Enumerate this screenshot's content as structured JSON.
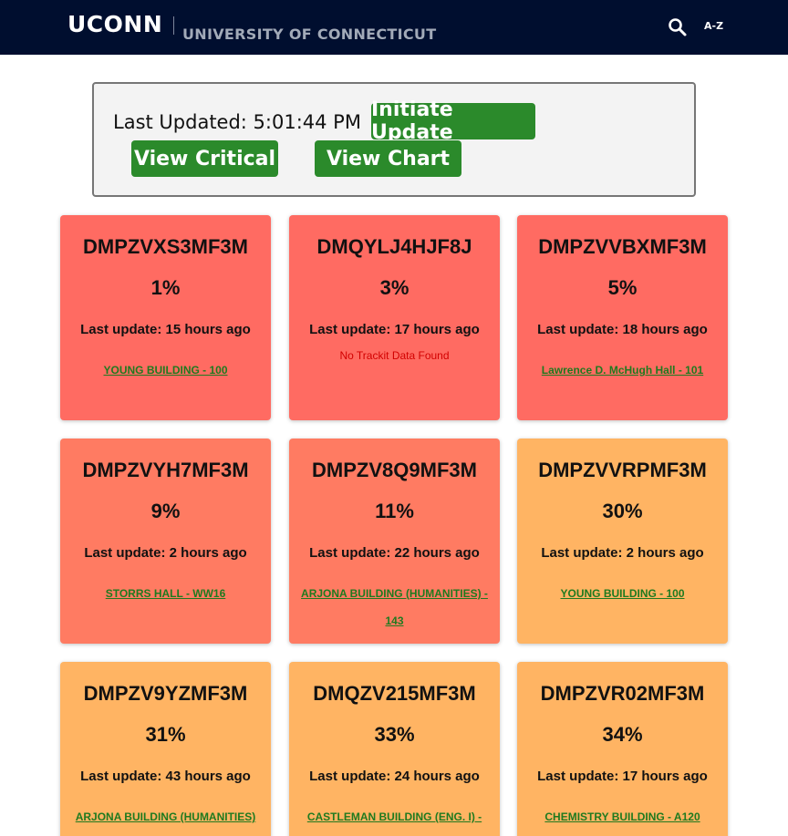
{
  "header": {
    "logo_word": "UCONN",
    "logo_subtitle": "UNIVERSITY OF CONNECTICUT",
    "az_label": "A-Z",
    "search_icon": "search-icon",
    "background": "#000e2f"
  },
  "controls": {
    "last_updated": "Last Updated: 5:01:44 PM",
    "initiate_update": "Initiate Update",
    "view_critical": "View Critical",
    "view_chart": "View Chart",
    "button_color": "#2b8a2b"
  },
  "status_colors": {
    "red": "#ff6b62",
    "salmon": "#ff7b62",
    "orange": "#ffb463"
  },
  "cards": [
    {
      "id": "DMPZVXS3MF3M",
      "percent": "1%",
      "last_update": "Last update: 15 hours ago",
      "location": "YOUNG BUILDING - 100",
      "status": "red"
    },
    {
      "id": "DMQYLJ4HJF8J",
      "percent": "3%",
      "last_update": "Last update: 17 hours ago",
      "location": "No Trackit Data Found",
      "status": "red"
    },
    {
      "id": "DMPZVVBXMF3M",
      "percent": "5%",
      "last_update": "Last update: 18 hours ago",
      "location": "Lawrence D. McHugh Hall - 101",
      "status": "red"
    },
    {
      "id": "DMPZVYH7MF3M",
      "percent": "9%",
      "last_update": "Last update: 2 hours ago",
      "location": "STORRS HALL - WW16",
      "status": "salmon"
    },
    {
      "id": "DMPZV8Q9MF3M",
      "percent": "11%",
      "last_update": "Last update: 22 hours ago",
      "location": "ARJONA BUILDING (HUMANITIES) - 143",
      "status": "salmon"
    },
    {
      "id": "DMPZVVRPMF3M",
      "percent": "30%",
      "last_update": "Last update: 2 hours ago",
      "location": "YOUNG BUILDING - 100",
      "status": "orange"
    },
    {
      "id": "DMPZV9YZMF3M",
      "percent": "31%",
      "last_update": "Last update: 43 hours ago",
      "location": "ARJONA BUILDING (HUMANITIES)",
      "status": "orange"
    },
    {
      "id": "DMQZV215MF3M",
      "percent": "33%",
      "last_update": "Last update: 24 hours ago",
      "location": "CASTLEMAN BUILDING (ENG. I) -",
      "status": "orange"
    },
    {
      "id": "DMPZVR02MF3M",
      "percent": "34%",
      "last_update": "Last update: 17 hours ago",
      "location": "CHEMISTRY BUILDING - A120",
      "status": "orange"
    }
  ]
}
